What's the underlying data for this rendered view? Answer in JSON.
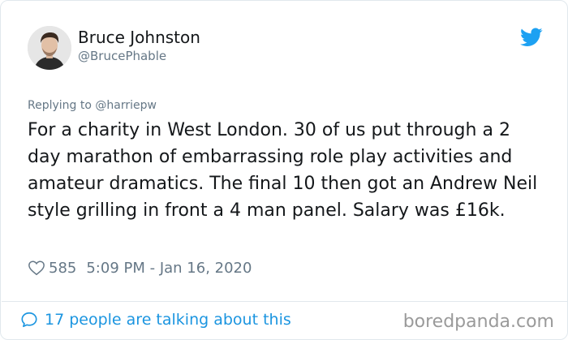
{
  "author": {
    "name": "Bruce Johnston",
    "handle": "@BrucePhable"
  },
  "reply": {
    "prefix": "Replying to ",
    "mention": "@harriepw"
  },
  "tweet": {
    "text": "For a charity in West London. 30 of us put through a 2 day marathon of embarrassing role play activities and amateur dramatics. The final 10 then got an Andrew Neil style grilling in front a 4 man panel. Salary was £16k."
  },
  "meta": {
    "likes": "585",
    "timestamp": "5:09 PM - Jan 16, 2020"
  },
  "conversation": {
    "label": "17 people are talking about this"
  },
  "watermark": "boredpanda.com",
  "colors": {
    "twitter_blue": "#1da1f2",
    "link_blue": "#1b95e0",
    "secondary_text": "#657786"
  },
  "icons": {
    "brand": "twitter-bird-icon",
    "like": "heart-icon",
    "conversation": "speech-bubble-icon"
  }
}
